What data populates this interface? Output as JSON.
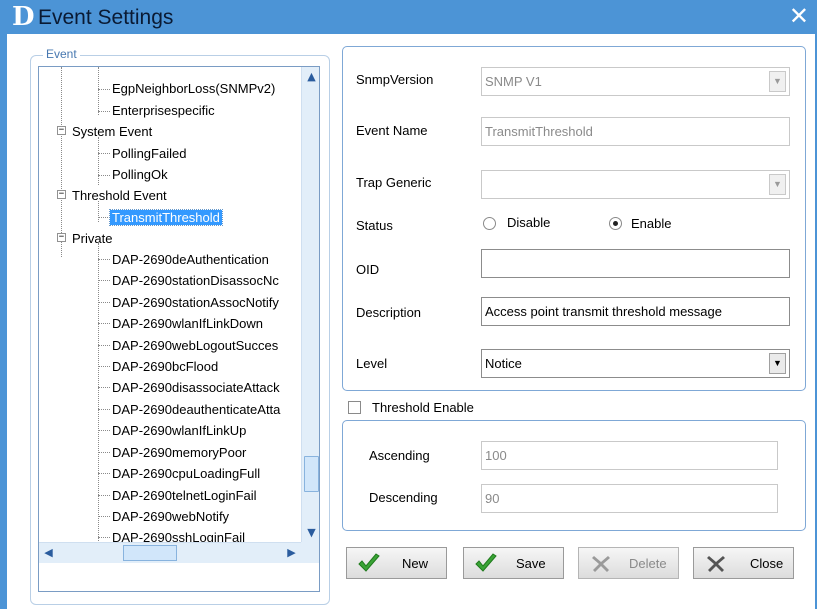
{
  "window": {
    "title": "Event Settings",
    "close_glyph": "✕"
  },
  "event_group": {
    "legend": "Event"
  },
  "tree": {
    "items": [
      {
        "label": "EgpNeighborLoss(SNMPv2)"
      },
      {
        "label": "Enterprisespecific"
      },
      {
        "label": "System Event"
      },
      {
        "label": "PollingFailed"
      },
      {
        "label": "PollingOk"
      },
      {
        "label": "Threshold Event"
      },
      {
        "label": "TransmitThreshold",
        "selected": true
      },
      {
        "label": "Private"
      },
      {
        "label": "DAP-2690deAuthentication"
      },
      {
        "label": "DAP-2690stationDisassocNc"
      },
      {
        "label": "DAP-2690stationAssocNotify"
      },
      {
        "label": "DAP-2690wlanIfLinkDown"
      },
      {
        "label": "DAP-2690webLogoutSucces"
      },
      {
        "label": "DAP-2690bcFlood"
      },
      {
        "label": "DAP-2690disassociateAttack"
      },
      {
        "label": "DAP-2690deauthenticateAtta"
      },
      {
        "label": "DAP-2690wlanIfLinkUp"
      },
      {
        "label": "DAP-2690memoryPoor"
      },
      {
        "label": "DAP-2690cpuLoadingFull"
      },
      {
        "label": "DAP-2690telnetLoginFail"
      },
      {
        "label": "DAP-2690webNotify"
      },
      {
        "label": "DAP-2690sshLoginFail"
      }
    ],
    "expander_glyph": "−",
    "scroll_up": "▲",
    "scroll_down": "▼",
    "scroll_left": "◀",
    "scroll_right": "▶"
  },
  "form": {
    "snmp_version_label": "SnmpVersion",
    "snmp_version_value": "SNMP V1",
    "event_name_label": "Event Name",
    "event_name_value": "TransmitThreshold",
    "trap_generic_label": "Trap Generic",
    "trap_generic_value": "",
    "status_label": "Status",
    "status_disable": "Disable",
    "status_enable": "Enable",
    "status_selected": "Enable",
    "oid_label": "OID",
    "oid_value": "",
    "description_label": "Description",
    "description_value": "Access point transmit threshold message",
    "level_label": "Level",
    "level_value": "Notice",
    "dropdown_glyph": "▼"
  },
  "threshold": {
    "enable_label": "Threshold Enable",
    "enabled": false,
    "ascending_label": "Ascending",
    "ascending_value": "100",
    "descending_label": "Descending",
    "descending_value": "90"
  },
  "buttons": {
    "new": "New",
    "save": "Save",
    "delete": "Delete",
    "close": "Close"
  },
  "colors": {
    "title_bar": "#4c94d6",
    "selection": "#3399ff",
    "check_green": "#3aa336"
  }
}
